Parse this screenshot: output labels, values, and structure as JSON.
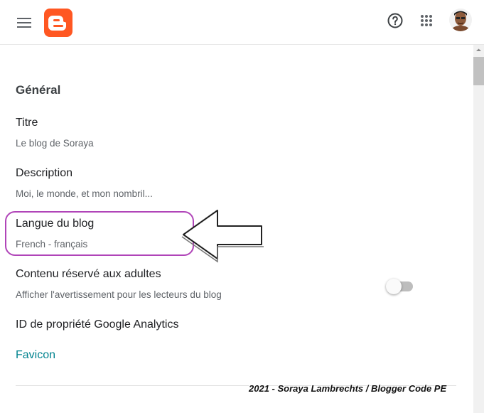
{
  "header": {
    "menu_icon": "hamburger-menu-icon",
    "logo_icon": "blogger-logo-icon",
    "help_icon": "help-circle-icon",
    "apps_icon": "apps-grid-icon",
    "avatar_icon": "user-avatar",
    "brand_color": "#ff5722"
  },
  "settings": {
    "section_title": "Général",
    "title_label": "Titre",
    "title_value": "Le blog de Soraya",
    "description_label": "Description",
    "description_value": "Moi, le monde, et mon nombril...",
    "language_label": "Langue du blog",
    "language_value": "French - français",
    "adult_label": "Contenu réservé aux adultes",
    "adult_desc": "Afficher l'avertissement pour les lecteurs du blog",
    "adult_enabled": false,
    "analytics_label": "ID de propriété Google Analytics",
    "favicon_label": "Favicon",
    "link_color": "#00838f"
  },
  "annotation": {
    "highlight_color": "#b044b8",
    "arrow_icon": "left-arrow-icon"
  },
  "watermark": "2021 - Soraya Lambrechts / Blogger Code PE"
}
